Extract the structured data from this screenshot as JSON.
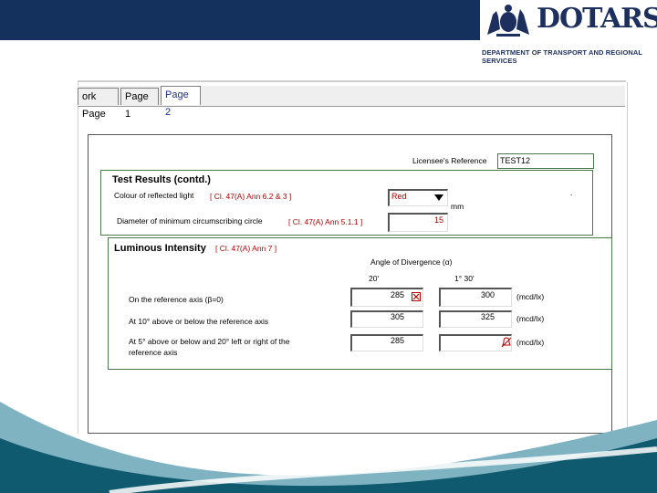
{
  "header": {
    "brand": "DOTARS",
    "department": "DEPARTMENT OF TRANSPORT AND REGIONAL SERVICES",
    "bar_color": "#14315e"
  },
  "tabs": [
    {
      "label": "ork Page",
      "active": false
    },
    {
      "label": "Page 1",
      "active": false
    },
    {
      "label": "Page 2",
      "active": true
    }
  ],
  "form": {
    "licensee_ref_label": "Licensee's Reference",
    "licensee_ref_value": "TEST12",
    "section_title": "Test Results (contd.)",
    "colour_label": "Colour of reflected light",
    "colour_ref": "[ Cl. 47(A) Ann 6.2 & 3 ]",
    "colour_value": "Red",
    "diameter_label": "Diameter of minimum circumscribing circle",
    "diameter_ref": "[ Cl. 47(A) Ann 5.1.1 ]",
    "diameter_value": "15",
    "diameter_unit": "mm",
    "stray_mark": ".",
    "luminous": {
      "title": "Luminous Intensity",
      "ref": "[ Cl. 47(A) Ann 7 ]",
      "angle_header": "Angle of Divergence (α)",
      "col1": "20'",
      "col2": "1° 30'",
      "rows": [
        {
          "label": "On the reference axis (β=0)",
          "v1": "285",
          "v2": "300",
          "unit": "(mcd/lx)"
        },
        {
          "label": "At 10° above or below the reference axis",
          "v1": "305",
          "v2": "325",
          "unit": "(mcd/lx)"
        },
        {
          "label_line1": "At 5° above or below and 20° left or right of the",
          "label_line2": "reference axis",
          "v1": "285",
          "v2": "",
          "unit": "(mcd/lx)"
        }
      ]
    }
  },
  "colors": {
    "ref_text": "#b40000",
    "group_border": "#4a7a4a",
    "wave_dark": "#0f5a6e",
    "wave_light": "#7fb3c2"
  }
}
